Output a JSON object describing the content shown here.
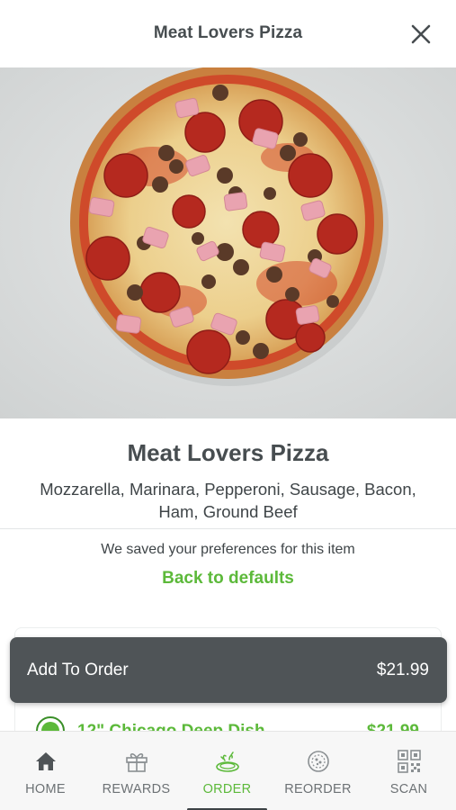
{
  "header": {
    "title": "Meat Lovers Pizza",
    "close_icon": "close-icon"
  },
  "product": {
    "image": "pizza-photo",
    "title": "Meat Lovers Pizza",
    "description": "Mozzarella, Marinara, Pepperoni, Sausage, Bacon, Ham, Ground Beef"
  },
  "preferences": {
    "note": "We saved your preferences for this item",
    "back_to_defaults": "Back to defaults"
  },
  "options": [
    {
      "label": "12\" Chicago Deep Dish",
      "price": "$21.99",
      "selected": true
    }
  ],
  "add_to_order": {
    "label": "Add To Order",
    "price": "$21.99"
  },
  "tabbar": {
    "items": [
      {
        "label": "HOME",
        "icon": "home-icon",
        "active": false
      },
      {
        "label": "REWARDS",
        "icon": "gift-icon",
        "active": false
      },
      {
        "label": "ORDER",
        "icon": "pizza-order-icon",
        "active": true
      },
      {
        "label": "REORDER",
        "icon": "reorder-pizza-icon",
        "active": false
      },
      {
        "label": "SCAN",
        "icon": "qr-code-icon",
        "active": false
      }
    ]
  },
  "colors": {
    "accent_green": "#5cb93a",
    "button_dark": "#4f5457",
    "text_dark": "#474d50"
  }
}
